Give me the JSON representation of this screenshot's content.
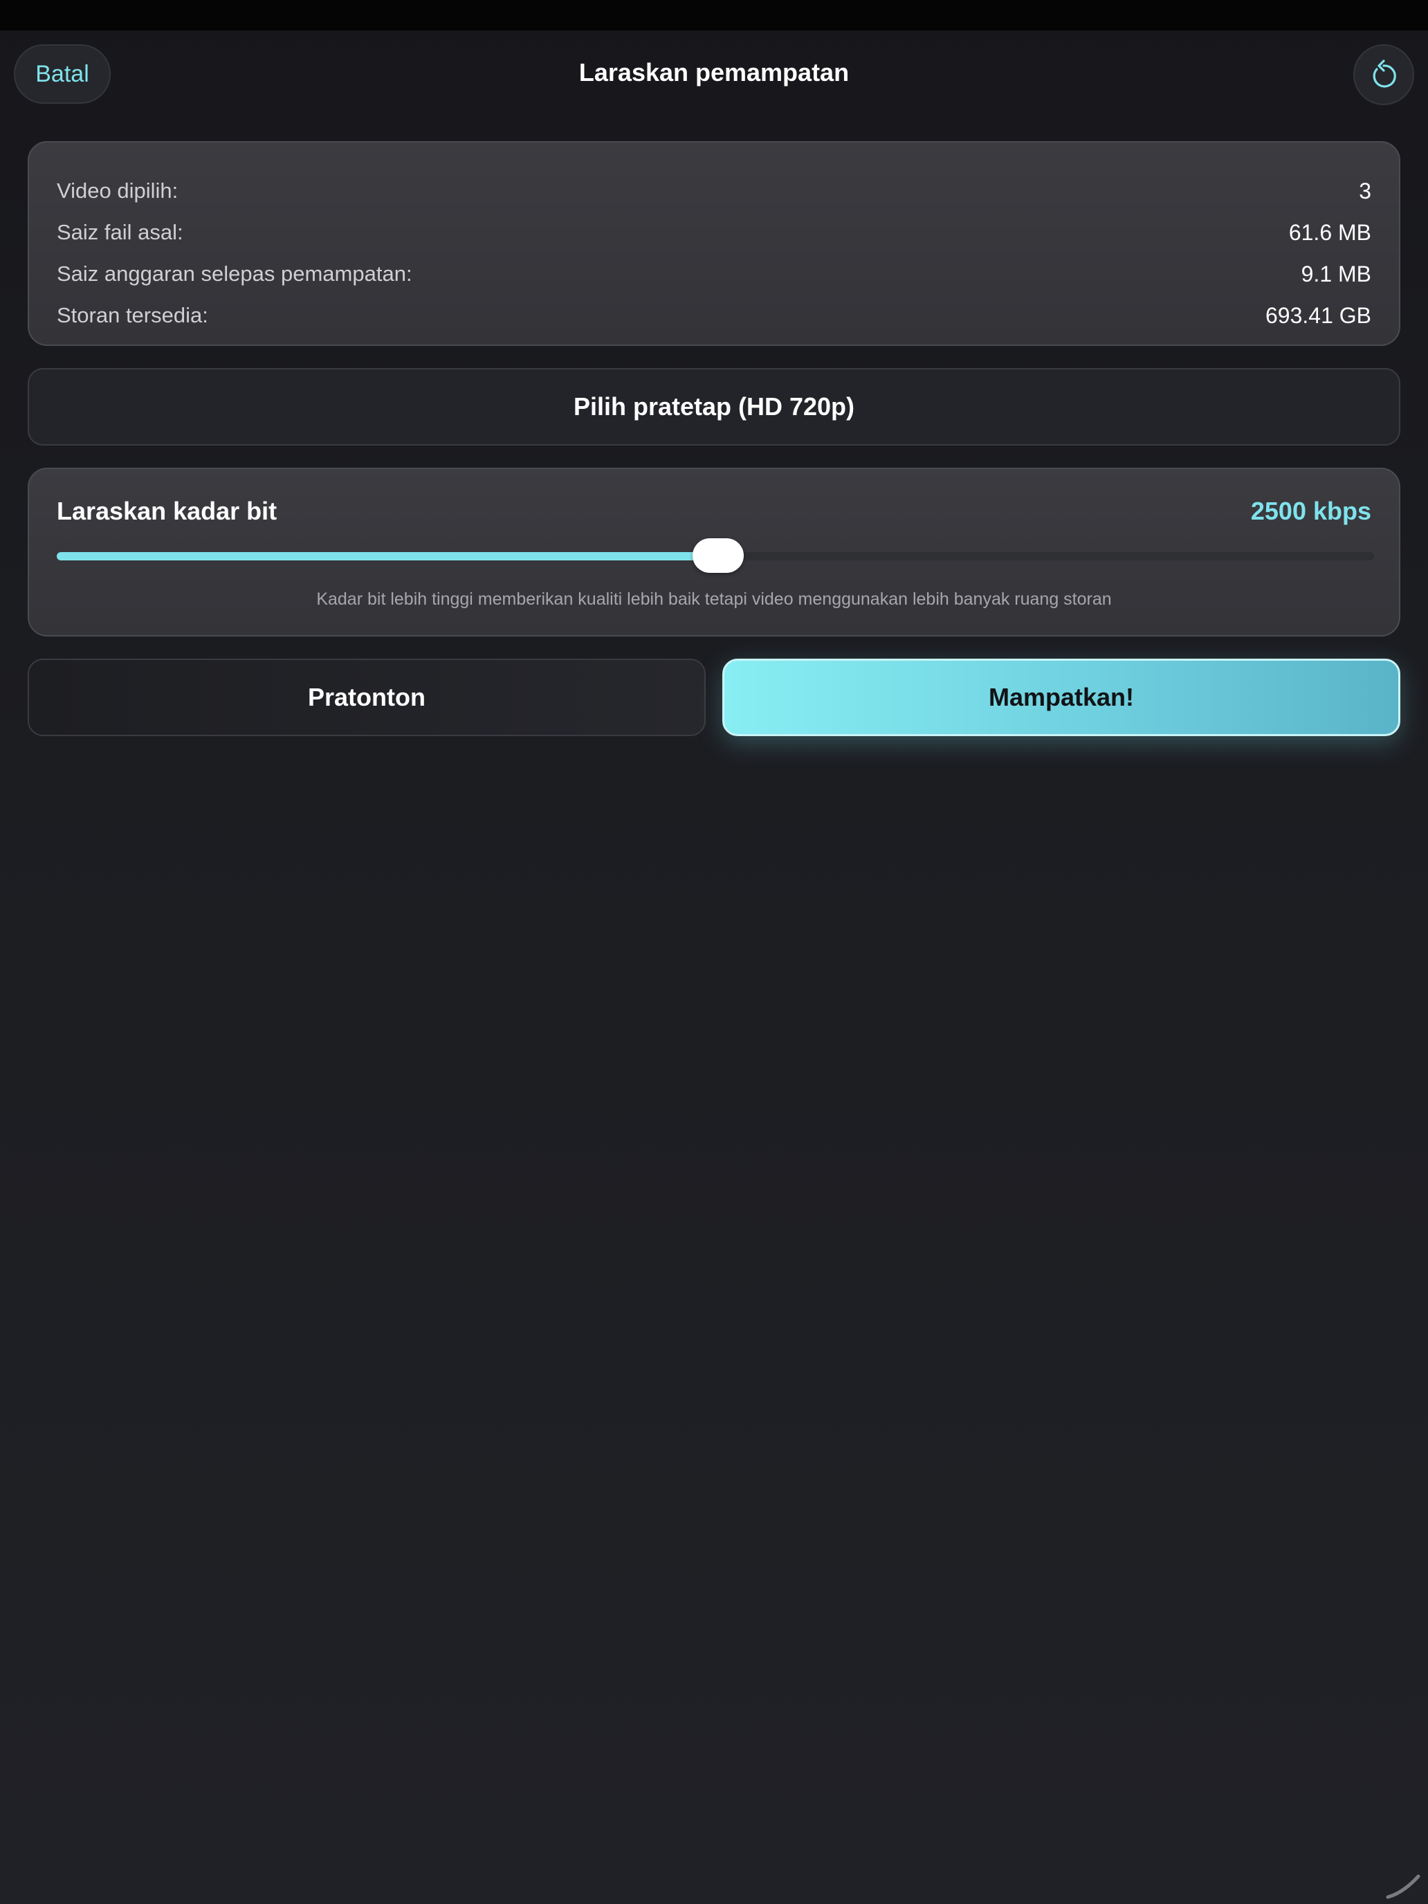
{
  "nav": {
    "cancel_label": "Batal",
    "title": "Laraskan pemampatan",
    "reset_icon": "rotate-ccw-icon"
  },
  "summary": {
    "rows": [
      {
        "label": "Video dipilih:",
        "value": "3"
      },
      {
        "label": "Saiz fail asal:",
        "value": "61.6 MB"
      },
      {
        "label": "Saiz anggaran selepas pemampatan:",
        "value": "9.1 MB"
      },
      {
        "label": "Storan tersedia:",
        "value": "693.41 GB"
      }
    ]
  },
  "preset": {
    "label": "Pilih pratetap (HD 720p)"
  },
  "bitrate": {
    "title": "Laraskan kadar bit",
    "value_label": "2500 kbps",
    "slider_fraction": 0.502,
    "hint": "Kadar bit lebih tinggi memberikan kualiti lebih baik tetapi video menggunakan lebih banyak ruang storan"
  },
  "actions": {
    "preview_label": "Pratonton",
    "compress_label": "Mampatkan!"
  },
  "colors": {
    "accent": "#7fe3ec",
    "background": "#1c1d21",
    "card": "#38383d"
  }
}
